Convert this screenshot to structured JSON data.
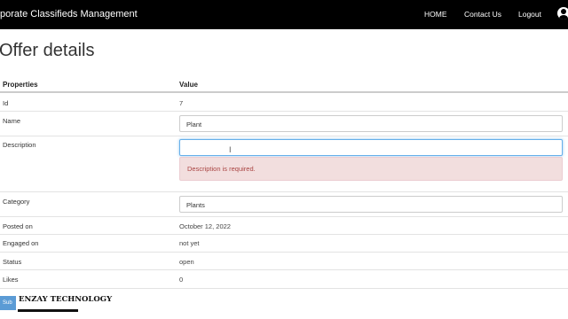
{
  "navbar": {
    "brand": "porate Classifieds Management",
    "links": [
      "HOME",
      "Contact Us",
      "Logout"
    ]
  },
  "page": {
    "title": "Offer details"
  },
  "table": {
    "headers": [
      "Properties",
      "Value"
    ],
    "rows": {
      "id": {
        "label": "Id",
        "value": "7"
      },
      "name": {
        "label": "Name",
        "value": "Plant"
      },
      "description": {
        "label": "Description",
        "value": "",
        "error": "Description is required."
      },
      "category": {
        "label": "Category",
        "value": "Plants"
      },
      "posted_on": {
        "label": "Posted on",
        "value": "October 12, 2022"
      },
      "engaged_on": {
        "label": "Engaged on",
        "value": "not yet"
      },
      "status": {
        "label": "Status",
        "value": "open"
      },
      "likes": {
        "label": "Likes",
        "value": "0"
      }
    }
  },
  "submit_label": "Sub",
  "watermark": "ENZAY TECHNOLOGY",
  "colors": {
    "navbar_bg": "#000000",
    "focus_border": "#66afe9",
    "error_bg": "#f2dede",
    "error_text": "#a94442",
    "button": "#5b9bd5"
  },
  "icons": {
    "user": "user-circle-icon"
  }
}
